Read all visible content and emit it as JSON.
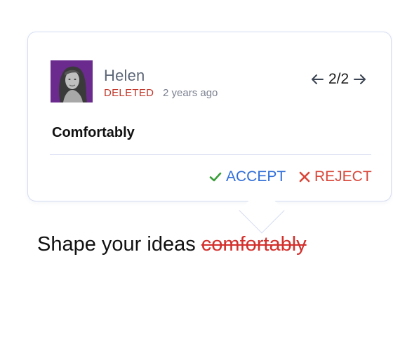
{
  "suggestion": {
    "author": "Helen",
    "status": "DELETED",
    "time": "2 years ago",
    "pager": "2/2",
    "comment": "Comfortably",
    "accept_label": "ACCEPT",
    "reject_label": "REJECT"
  },
  "document": {
    "text": "Shape your ideas",
    "deleted_word": "comfortably"
  },
  "colors": {
    "accept": "#2f6ed8",
    "accept_check": "#3a9e3a",
    "reject": "#d9473a",
    "deleted": "#d3302c",
    "avatar_bg": "#6b2a8e",
    "card_border": "#d5dcf2"
  },
  "icons": {
    "prev": "arrow-left-icon",
    "next": "arrow-right-icon",
    "accept": "check-icon",
    "reject": "close-icon"
  }
}
